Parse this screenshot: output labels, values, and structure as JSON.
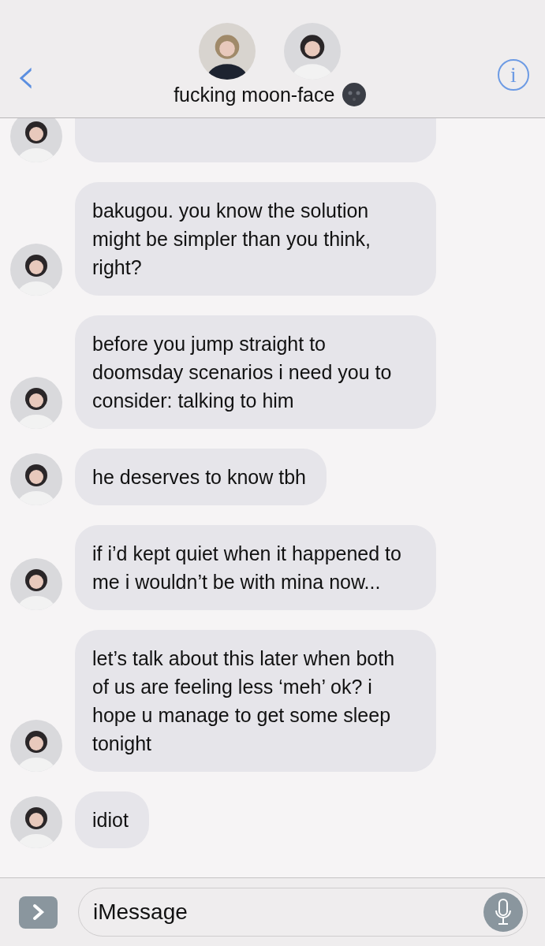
{
  "header": {
    "back": "‹",
    "title": "fucking moon-face",
    "info": "i"
  },
  "messages": [
    {
      "kind": "cut"
    },
    {
      "kind": "received",
      "text": "bakugou. you know the solution might be simpler than you think, right?"
    },
    {
      "kind": "received",
      "text": "before you jump straight to doomsday scenarios i need you to consider: talking to him"
    },
    {
      "kind": "received",
      "text": "he deserves to know tbh"
    },
    {
      "kind": "received",
      "text": "if i’d kept quiet when it happened to me i wouldn’t be with mina now..."
    },
    {
      "kind": "received",
      "text": "let’s talk about this later when both of us are feeling less ‘meh’ ok? i hope u manage to get some sleep tonight"
    },
    {
      "kind": "received",
      "text": "idiot"
    }
  ],
  "composer": {
    "placeholder": "iMessage"
  }
}
